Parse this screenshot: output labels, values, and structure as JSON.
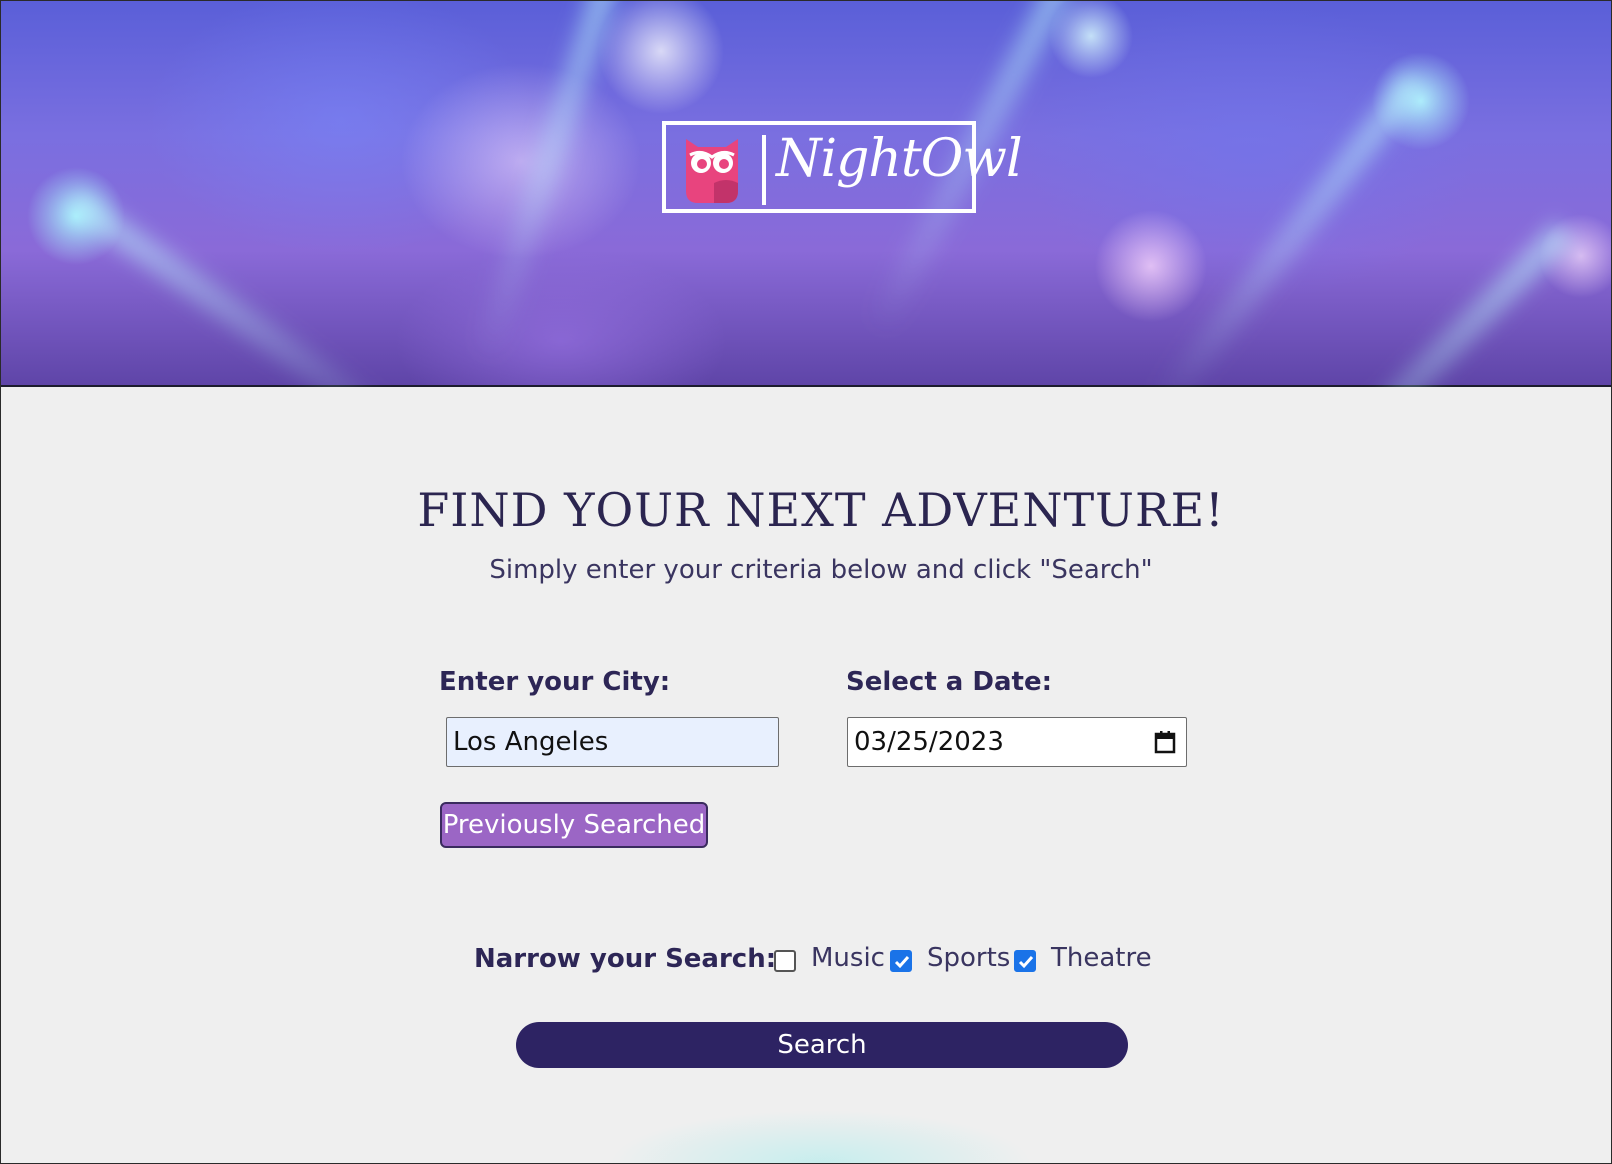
{
  "header": {
    "logo_text": "NightOwl"
  },
  "hero": {
    "title": "FIND YOUR NEXT ADVENTURE!",
    "subtitle": "Simply enter your criteria below and click \"Search\""
  },
  "form": {
    "city_label": "Enter your City:",
    "city_value": "Los Angeles",
    "date_label": "Select a Date:",
    "date_value": "03/25/2023",
    "previously_searched_label": "Previously Searched",
    "narrow_label": "Narrow your Search:",
    "filters": [
      {
        "label": "Music",
        "checked": false
      },
      {
        "label": "Sports",
        "checked": true
      },
      {
        "label": "Theatre",
        "checked": true
      }
    ],
    "search_label": "Search"
  },
  "colors": {
    "primary_dark": "#2d2363",
    "accent_purple": "#9b66c5",
    "owl_pink": "#e8447e",
    "checkbox_blue": "#1a73e8"
  }
}
